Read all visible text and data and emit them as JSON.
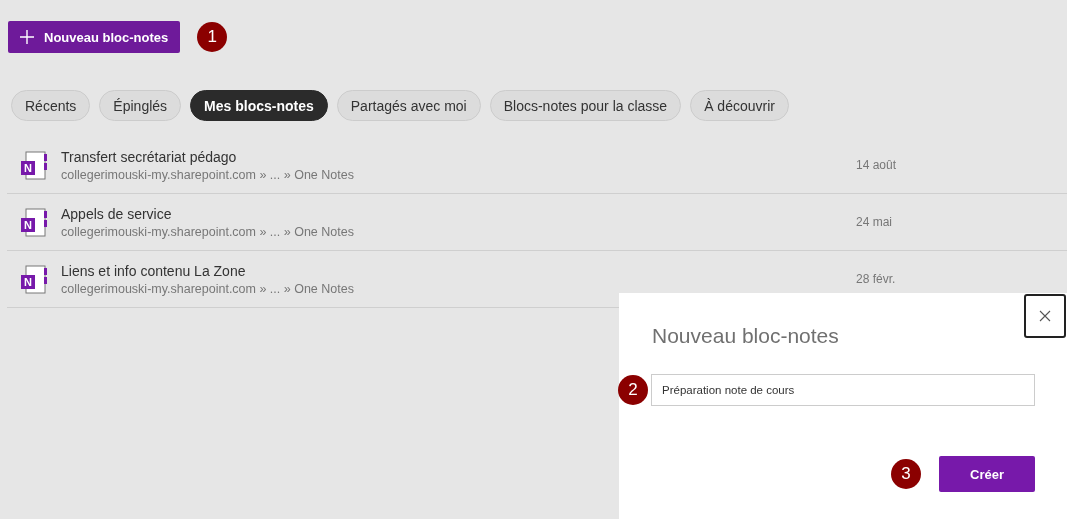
{
  "new_button": {
    "label": "Nouveau bloc-notes",
    "callout": "1"
  },
  "tabs": [
    {
      "label": "Récents",
      "selected": false
    },
    {
      "label": "Épinglés",
      "selected": false
    },
    {
      "label": "Mes blocs-notes",
      "selected": true
    },
    {
      "label": "Partagés avec moi",
      "selected": false
    },
    {
      "label": "Blocs-notes pour la classe",
      "selected": false
    },
    {
      "label": "À découvrir",
      "selected": false
    }
  ],
  "notebooks": [
    {
      "icon_letter": "N",
      "name": "Transfert secrétariat pédago",
      "location": "collegerimouski-my.sharepoint.com » ... » One Notes",
      "date": "14 août"
    },
    {
      "icon_letter": "N",
      "name": "Appels de service",
      "location": "collegerimouski-my.sharepoint.com » ... » One Notes",
      "date": "24 mai"
    },
    {
      "icon_letter": "N",
      "name": "Liens et info contenu La Zone",
      "location": "collegerimouski-my.sharepoint.com » ... » One Notes",
      "date": "28 févr."
    }
  ],
  "dialog": {
    "title": "Nouveau bloc-notes",
    "field_value": "Préparation note de cours",
    "field_callout": "2",
    "create_button": "Créer",
    "create_callout": "3"
  }
}
